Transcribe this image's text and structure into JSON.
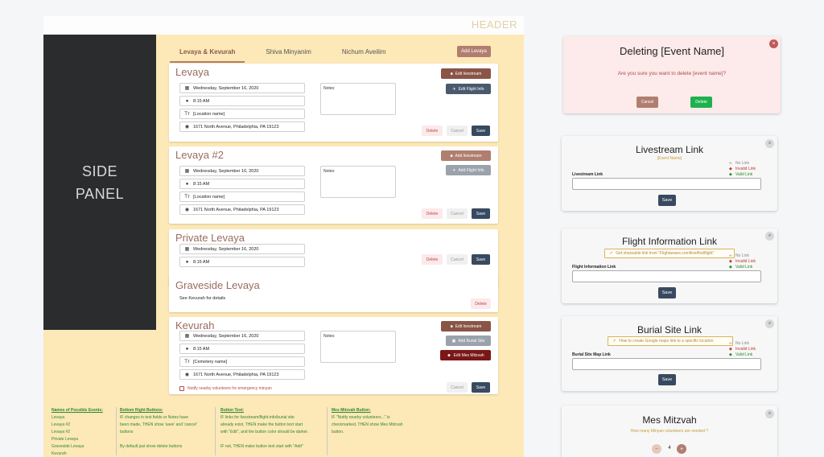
{
  "header": {
    "title": "HEADER"
  },
  "side_panel": {
    "label": "SIDE\nPANEL"
  },
  "tabs": [
    {
      "label": "Levaya & Kevurah",
      "active": true
    },
    {
      "label": "Shiva Minyanim",
      "active": false
    },
    {
      "label": "Nichum Aveilim",
      "active": false
    }
  ],
  "add_levaya_label": "Add Levaya",
  "common": {
    "notes_label": "Notes:",
    "delete_label": "Delete",
    "cancel_label": "Cancel",
    "save_label": "Save",
    "date": "Wednesday, September 16, 2020",
    "time": "8:15 AM",
    "location_placeholder": "[Location name]",
    "address": "1671 North Avenue, Philadelphia, PA 19123"
  },
  "cards": {
    "levaya": {
      "title": "Levaya",
      "livestream_btn": "Edit livestream",
      "flight_btn": "Edit Flight Info"
    },
    "levaya2": {
      "title": "Levaya #2",
      "livestream_btn": "Add livestream",
      "flight_btn": "Add Flight Info"
    },
    "private": {
      "title": "Private Levaya"
    },
    "graveside": {
      "title": "Graveside Levaya",
      "text": "See Kevurah for details"
    },
    "kevurah": {
      "title": "Kevurah",
      "cemetery_placeholder": "[Cemetery name]",
      "livestream_btn": "Edit livestream",
      "burial_btn": "Add Burial Site",
      "mitzvah_btn": "Edit Mes Mitzvah",
      "notify_label": "Notify nearby volunteers for emergency minyan"
    }
  },
  "notes_section": {
    "col1": {
      "heading": "Names of Possible Events:",
      "lines": [
        "Levaya",
        "Levaya #2",
        "Levaya #2",
        "Private Levaya",
        "Graveside Levaya",
        "Kevurah"
      ]
    },
    "col2": {
      "heading": "Bottom Right Buttons:",
      "lines": [
        "IF changes in text fields or Notes have",
        "been made, THEN show 'save' and 'cancel'",
        "buttons",
        "",
        "By default just show delete buttons"
      ]
    },
    "col3": {
      "heading": "Button Text:",
      "lines": [
        "IF links for livestream/flight-info/burial site",
        "already exist, THEN make the button text start",
        "with \"Edit\", and the button color should be darker.",
        "",
        "IF not, THEN make button text start with \"Add\""
      ]
    },
    "col4": {
      "heading": "Mes Mitzvah Button:",
      "lines": [
        "IF \"Notify nearby volunteers...\" is",
        "checkmarked, THEN show Mes Mitzvah",
        "button."
      ]
    }
  },
  "delete_modal": {
    "title": "Deleting [Event Name]",
    "question": "Are you sure you want to delete [event name]?",
    "cancel_label": "Cancel",
    "delete_label": "Delete"
  },
  "legend": {
    "no_link": "No Link",
    "invalid": "Invalid Link",
    "valid": "Valid Link"
  },
  "livestream_modal": {
    "title": "Livestream Link",
    "subtitle": "[Event Name]",
    "field_label": "Livestream Link",
    "save_label": "Save"
  },
  "flight_modal": {
    "title": "Flight Information Link",
    "hint": "Get shareable link from \"Flightaware.com/live/findflight\"",
    "field_label": "Flight Information Link",
    "save_label": "Save"
  },
  "burial_modal": {
    "title": "Burial Site Link",
    "hint": "How to create Google maps link to a specific location",
    "field_label": "Burial Site Map Link",
    "save_label": "Save"
  },
  "mitzvah_modal": {
    "title": "Mes Mitzvah",
    "subtitle": "How many Minyan volunteers are needed ?",
    "count": "4"
  },
  "colors": {
    "accent_brown": "#8a5446",
    "page_bg": "#fde8b7",
    "navy": "#384a60",
    "green": "#2f8a2f",
    "red": "#c0392b"
  }
}
